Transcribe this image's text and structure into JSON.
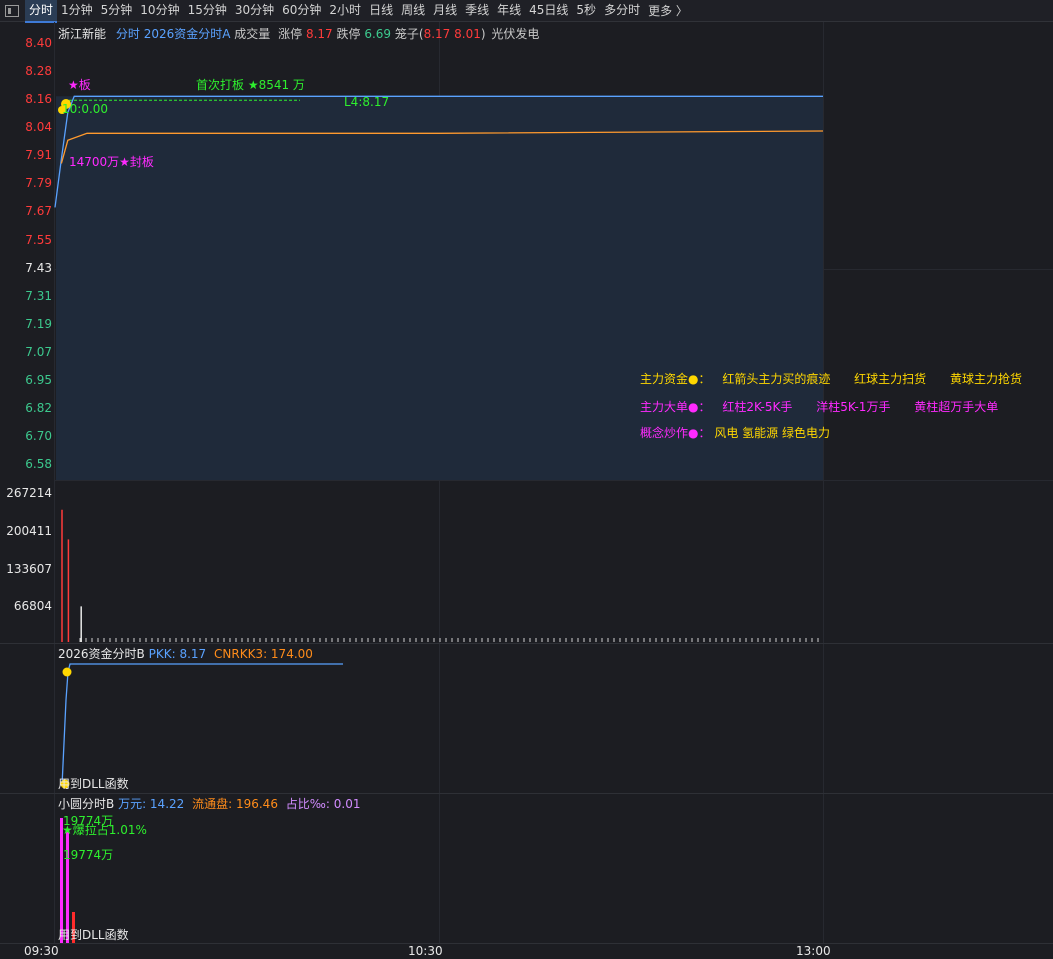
{
  "toolbar": {
    "tabs": [
      "分时",
      "1分钟",
      "5分钟",
      "10分钟",
      "15分钟",
      "30分钟",
      "60分钟",
      "2小时",
      "日线",
      "周线",
      "月线",
      "季线",
      "年线",
      "45日线",
      "5秒",
      "多分时"
    ],
    "active_tab": "分时",
    "more_label": "更多 〉"
  },
  "header": {
    "stock_name": "浙江新能",
    "chart_mode": "分时",
    "formula_name": "2026资金分时A",
    "volume_label": "成交量",
    "limit_up_label": "涨停",
    "limit_up_value": "8.17",
    "limit_down_label": "跌停",
    "limit_down_value": "6.69",
    "cage_label": "笼子(",
    "cage_high": "8.17",
    "cage_low": "8.01",
    "cage_close": ")",
    "sector": "光伏发电"
  },
  "price_axis": {
    "up_labels": [
      "8.40",
      "8.28",
      "8.16",
      "8.04",
      "7.91",
      "7.79",
      "7.67",
      "7.55"
    ],
    "prev_close": "7.43",
    "down_labels": [
      "7.31",
      "7.19",
      "7.07",
      "6.95",
      "6.82",
      "6.70",
      "6.58"
    ]
  },
  "volume_axis": [
    "267214",
    "200411",
    "133607",
    "66804"
  ],
  "annotations": {
    "star_board": "★板",
    "first_hit": "首次打板 ★8541 万",
    "time_marker": "10:0.00",
    "l4": "L4:8.17",
    "seal_amount": "14700万★封板"
  },
  "legend": {
    "row1": {
      "title": "主力资金●：",
      "a": "红箭头主力买的痕迹",
      "b": "红球主力扫货",
      "c": "黄球主力抢货"
    },
    "row2": {
      "title": "主力大单●：",
      "a": "红柱2K-5K手",
      "b": "洋柱5K-1万手",
      "c": "黄柱超万手大单"
    },
    "row3": {
      "title": "概念炒作●：",
      "a": "风电 氢能源 绿色电力"
    }
  },
  "panel_b": {
    "name": "2026资金分时B",
    "pkk_label": "PKK: 8.17",
    "cnrkk3_label": "CNRKK3: 174.00",
    "dll_text": "用到DLL函数"
  },
  "panel_c": {
    "name": "小圆分时B",
    "wan_label": "万元: 14.22",
    "float_label": "流通盘: 196.46",
    "ratio_label": "占比‰: 0.01",
    "bar_label_1": "19774万",
    "bar_label_2": "★爆拉占1.01%",
    "bar_label_3": "19774万",
    "dll_text": "用到DLL函数"
  },
  "time_axis": [
    "09:30",
    "10:30",
    "13:00"
  ],
  "colors": {
    "background": "#1c1d22",
    "up": "#ff3b3b",
    "down": "#3cc98e",
    "price_line": "#5aa2ff",
    "avg_line": "#ff9a2e",
    "magenta": "#ff2aff",
    "yellow": "#ffd700",
    "green": "#2ef02e"
  },
  "chart_data": {
    "type": "line",
    "price_series": {
      "name": "",
      "points": [
        [
          "09:30",
          7.69
        ],
        [
          "09:31",
          7.9
        ],
        [
          "09:32",
          8.1
        ],
        [
          "09:33",
          8.17
        ],
        [
          "11:30",
          8.17
        ]
      ]
    },
    "avg_series": {
      "name": "",
      "points": [
        [
          "09:31",
          7.88
        ],
        [
          "09:32",
          7.98
        ],
        [
          "09:35",
          8.01
        ],
        [
          "10:30",
          8.01
        ],
        [
          "11:30",
          8.02
        ]
      ]
    },
    "ylim": [
      6.46,
      8.4
    ],
    "prev_close": 7.43,
    "volume": [
      {
        "t": "09:30",
        "v": 245000,
        "color": "up"
      },
      {
        "t": "09:31",
        "v": 190000,
        "color": "up"
      },
      {
        "t": "09:33",
        "v": 66000,
        "color": "neutral"
      }
    ]
  }
}
